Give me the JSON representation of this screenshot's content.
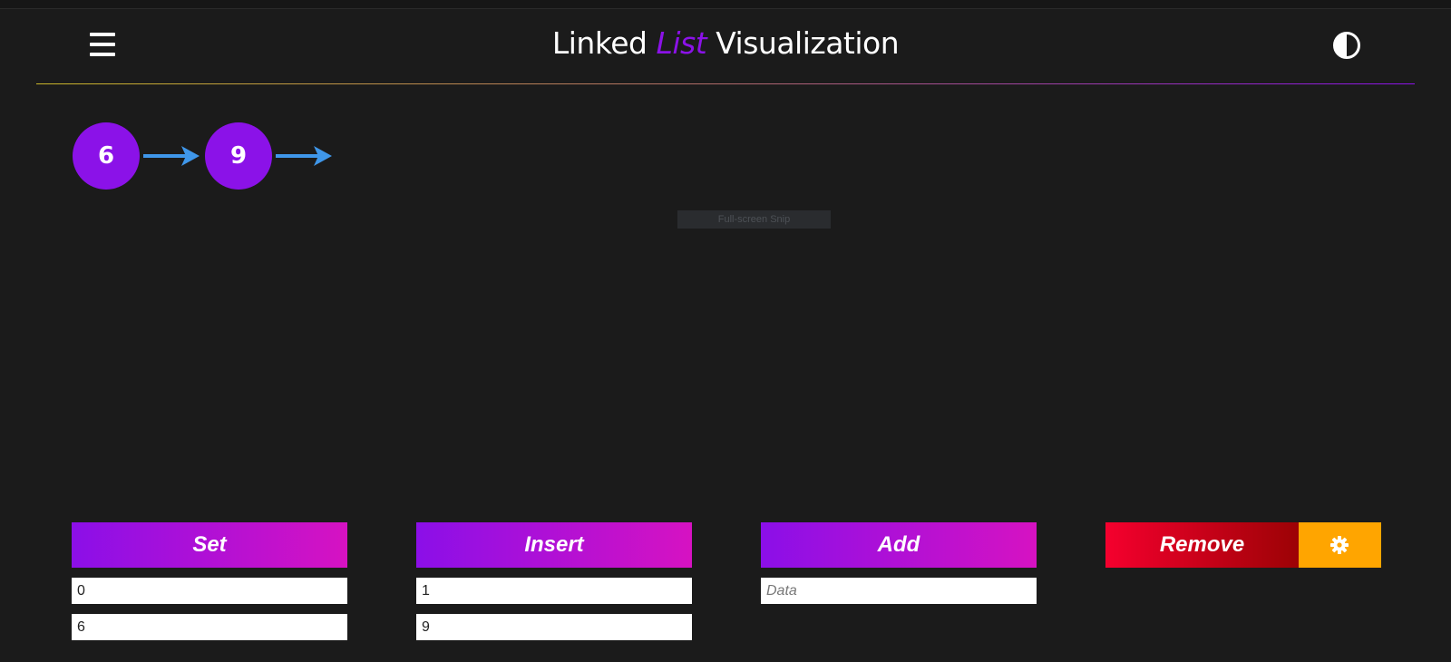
{
  "header": {
    "title_before": "Linked",
    "title_accent": "List",
    "title_after": "Visualization"
  },
  "icons": {
    "menu": "hamburger-menu-icon",
    "theme": "contrast-half-circle-icon",
    "arrow": "right-arrow-icon",
    "settings": "gear-icon"
  },
  "list": {
    "nodes": [
      "6",
      "9"
    ]
  },
  "overlay": {
    "snip_label": "Full-screen Snip"
  },
  "controls": {
    "set": {
      "label": "Set",
      "index_value": "0",
      "data_value": "6"
    },
    "insert": {
      "label": "Insert",
      "index_value": "1",
      "data_value": "9"
    },
    "add": {
      "label": "Add",
      "data_value": "",
      "data_placeholder": "Data"
    },
    "remove": {
      "label": "Remove"
    }
  },
  "colors": {
    "background": "#1b1b1b",
    "node": "#8b12e8",
    "arrow": "#3f97ea",
    "accent_purple": "#8b12e8",
    "button_gradient_start": "#8b0fe8",
    "button_gradient_end": "#d612c2",
    "remove_gradient_start": "#f5002e",
    "remove_gradient_end": "#9c0205",
    "settings": "#ffa500"
  }
}
